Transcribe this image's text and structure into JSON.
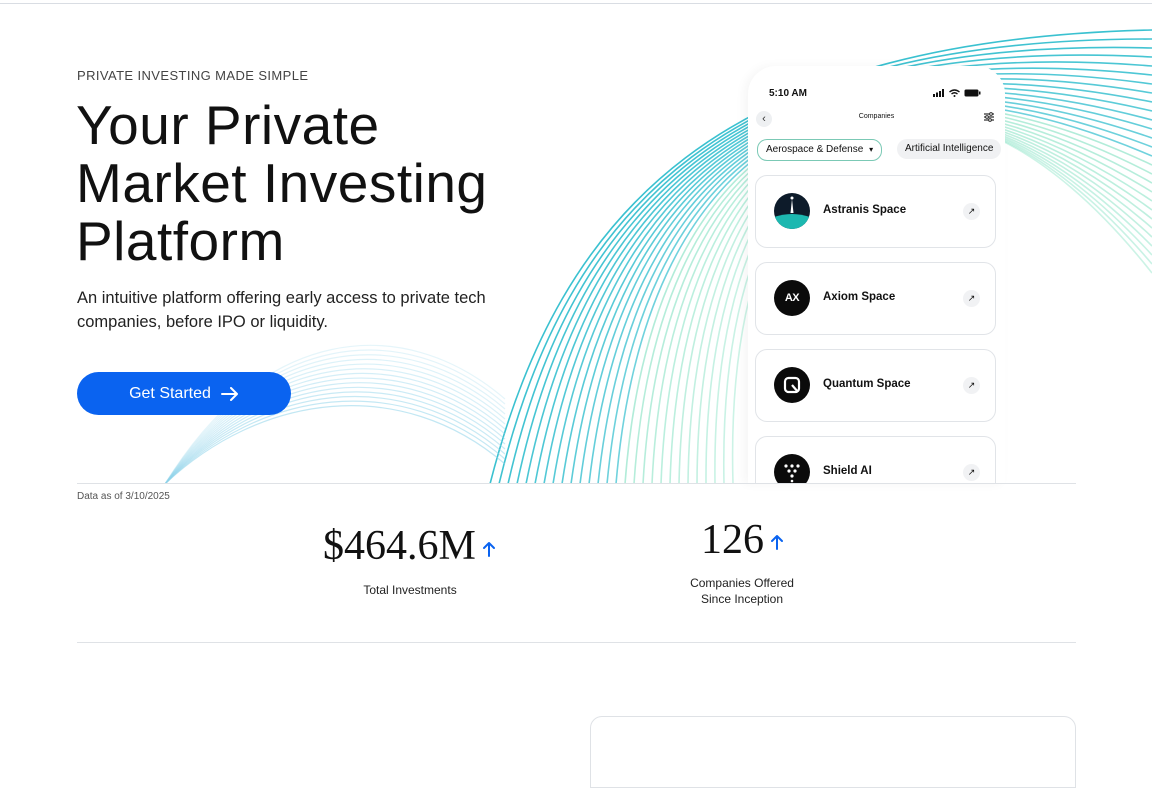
{
  "hero": {
    "eyebrow": "PRIVATE INVESTING MADE SIMPLE",
    "headline_line1": "Your Private",
    "headline_line2": "Market Investing",
    "headline_line3": "Platform",
    "subhead": "An intuitive platform offering early access to private tech companies, before IPO or liquidity.",
    "cta_label": "Get Started",
    "cta_icon": "arrow-right-icon"
  },
  "phone": {
    "time": "5:10 AM",
    "title": "Companies",
    "chips": [
      {
        "label": "Aerospace & Defense",
        "selected": true
      },
      {
        "label": "Artificial Intelligence",
        "selected": false
      }
    ],
    "companies": [
      {
        "name": "Astranis Space"
      },
      {
        "name": "Axiom Space",
        "logo_text": "AX"
      },
      {
        "name": "Quantum Space"
      },
      {
        "name": "Shield AI"
      }
    ]
  },
  "stats": {
    "as_of": "Data as of 3/10/2025",
    "items": [
      {
        "value": "$464.6M",
        "label_line1": "Total Investments",
        "label_line2": ""
      },
      {
        "value": "126",
        "label_line1": "Companies Offered",
        "label_line2": "Since Inception"
      }
    ]
  },
  "colors": {
    "primary": "#0a63f0",
    "wave_teal": "#18b6c8",
    "wave_mint": "#7fe0c0",
    "text": "#111111"
  }
}
